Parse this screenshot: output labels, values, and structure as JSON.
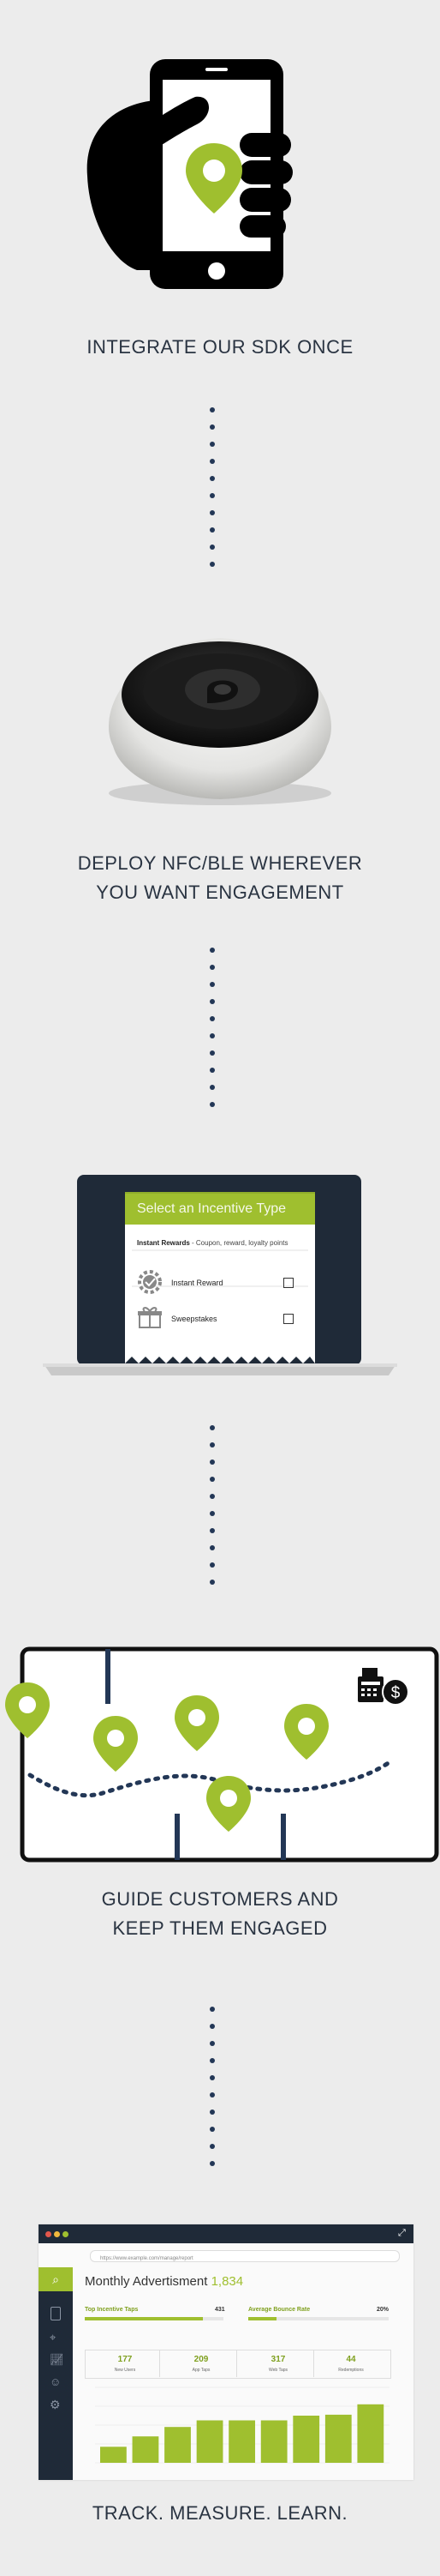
{
  "steps": [
    {
      "caption_lines": [
        "INTEGRATE OUR SDK ONCE"
      ]
    },
    {
      "caption_lines": [
        "DEPLOY NFC/BLE WHEREVER",
        "YOU WANT ENGAGEMENT"
      ]
    },
    {
      "caption_lines": []
    },
    {
      "caption_lines": [
        "GUIDE CUSTOMERS AND",
        "KEEP THEM ENGAGED"
      ]
    },
    {
      "caption_lines": [
        "TRACK. MEASURE. LEARN."
      ]
    }
  ],
  "incentive_screen": {
    "title": "Select an Incentive Type",
    "subtitle_bold": "Instant Rewards",
    "subtitle_rest": " - Coupon, reward, loyalty points",
    "options": [
      "Instant Reward",
      "Sweepstakes"
    ]
  },
  "dashboard": {
    "url": "https://www.example.com/manage/report",
    "title": "Monthly Advertisment",
    "count": "1,834",
    "kpis": [
      {
        "label": "Top Incentive Taps",
        "value": "431",
        "fill": 0.85
      },
      {
        "label": "Average Bounce Rate",
        "value": "20%",
        "fill": 0.2
      }
    ],
    "stats": [
      {
        "num": "177",
        "label": "New Users"
      },
      {
        "num": "209",
        "label": "App Taps"
      },
      {
        "num": "317",
        "label": "Web Taps"
      },
      {
        "num": "44",
        "label": "Redemptions"
      }
    ]
  },
  "chart_data": {
    "type": "bar",
    "categories": [
      "",
      "",
      "",
      "",
      "",
      "",
      "",
      "",
      ""
    ],
    "values": [
      17,
      28,
      38,
      45,
      45,
      45,
      50,
      51,
      62
    ],
    "ylim": [
      0,
      80
    ]
  },
  "colors": {
    "background": "#ececec",
    "accent": "#9fbf2f",
    "navy": "#233756",
    "text": "#2a3442"
  }
}
